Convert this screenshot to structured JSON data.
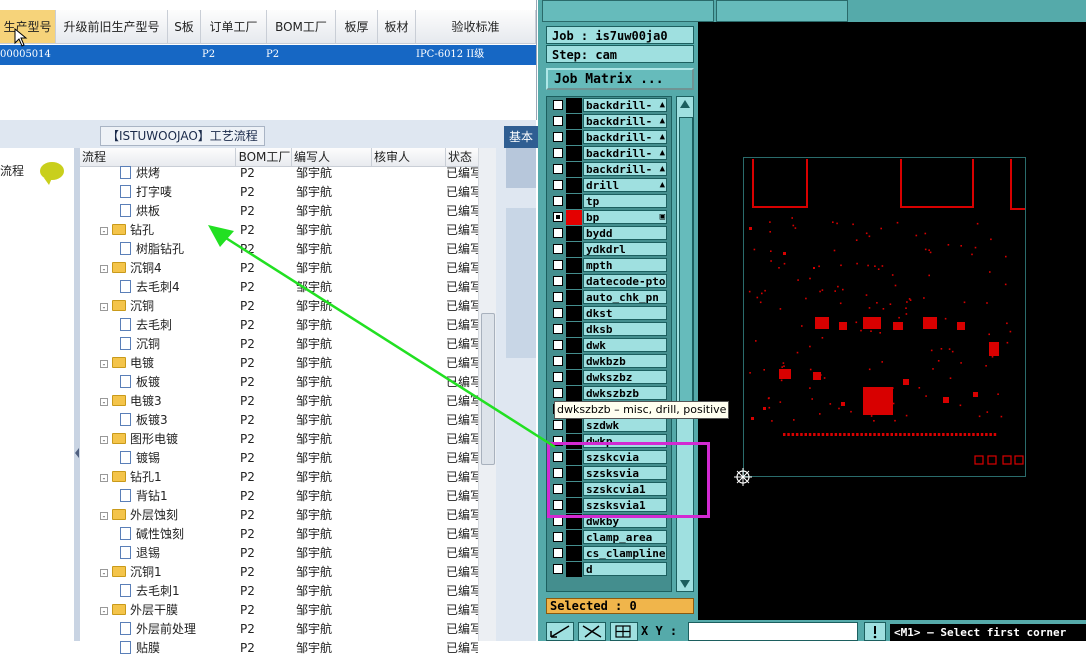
{
  "top_grid": {
    "headers": [
      "生产型号",
      "升级前旧生产型号",
      "S板",
      "订单工厂",
      "BOM工厂",
      "板厚",
      "板材",
      "验收标准"
    ],
    "row": {
      "model": "00005014",
      "order_factory": "P2",
      "bom_factory": "P2",
      "standard": "IPC-6012 II级"
    }
  },
  "process_panel": {
    "title": "【ISTUWOOJAO】工艺流程",
    "left_label": "流程",
    "tab_basic": "基本",
    "tree_headers": [
      "流程",
      "BOM工厂",
      "编写人",
      "核审人",
      "状态"
    ],
    "rows": [
      {
        "indent": 2,
        "kind": "doc",
        "name": "烘烤",
        "factory": "P2",
        "author": "邹宇航",
        "status": "已编写"
      },
      {
        "indent": 2,
        "kind": "doc",
        "name": "打字唛",
        "factory": "P2",
        "author": "邹宇航",
        "status": "已编写"
      },
      {
        "indent": 2,
        "kind": "doc",
        "name": "烘板",
        "factory": "P2",
        "author": "邹宇航",
        "status": "已编写"
      },
      {
        "indent": 1,
        "kind": "folder",
        "name": "钻孔",
        "factory": "P2",
        "author": "邹宇航",
        "status": "已编写"
      },
      {
        "indent": 2,
        "kind": "doc",
        "name": "树脂钻孔",
        "factory": "P2",
        "author": "邹宇航",
        "status": "已编写"
      },
      {
        "indent": 1,
        "kind": "folder",
        "name": "沉铜4",
        "factory": "P2",
        "author": "邹宇航",
        "status": "已编写"
      },
      {
        "indent": 2,
        "kind": "doc",
        "name": "去毛刺4",
        "factory": "P2",
        "author": "邹宇航",
        "status": "已编写"
      },
      {
        "indent": 1,
        "kind": "folder",
        "name": "沉铜",
        "factory": "P2",
        "author": "邹宇航",
        "status": "已编写"
      },
      {
        "indent": 2,
        "kind": "doc",
        "name": "去毛刺",
        "factory": "P2",
        "author": "邹宇航",
        "status": "已编写"
      },
      {
        "indent": 2,
        "kind": "doc",
        "name": "沉铜",
        "factory": "P2",
        "author": "邹宇航",
        "status": "已编写"
      },
      {
        "indent": 1,
        "kind": "folder",
        "name": "电镀",
        "factory": "P2",
        "author": "邹宇航",
        "status": "已编写"
      },
      {
        "indent": 2,
        "kind": "doc",
        "name": "板镀",
        "factory": "P2",
        "author": "邹宇航",
        "status": "已编写"
      },
      {
        "indent": 1,
        "kind": "folder",
        "name": "电镀3",
        "factory": "P2",
        "author": "邹宇航",
        "status": "已编写"
      },
      {
        "indent": 2,
        "kind": "doc",
        "name": "板镀3",
        "factory": "P2",
        "author": "邹宇航",
        "status": "已编写"
      },
      {
        "indent": 1,
        "kind": "folder",
        "name": "图形电镀",
        "factory": "P2",
        "author": "邹宇航",
        "status": "已编写"
      },
      {
        "indent": 2,
        "kind": "doc",
        "name": "镀锡",
        "factory": "P2",
        "author": "邹宇航",
        "status": "已编写"
      },
      {
        "indent": 1,
        "kind": "folder",
        "name": "钻孔1",
        "factory": "P2",
        "author": "邹宇航",
        "status": "已编写"
      },
      {
        "indent": 2,
        "kind": "doc",
        "name": "背钻1",
        "factory": "P2",
        "author": "邹宇航",
        "status": "已编写"
      },
      {
        "indent": 1,
        "kind": "folder",
        "name": "外层蚀刻",
        "factory": "P2",
        "author": "邹宇航",
        "status": "已编写"
      },
      {
        "indent": 2,
        "kind": "doc",
        "name": "碱性蚀刻",
        "factory": "P2",
        "author": "邹宇航",
        "status": "已编写"
      },
      {
        "indent": 2,
        "kind": "doc",
        "name": "退锡",
        "factory": "P2",
        "author": "邹宇航",
        "status": "已编写"
      },
      {
        "indent": 1,
        "kind": "folder",
        "name": "沉铜1",
        "factory": "P2",
        "author": "邹宇航",
        "status": "已编写"
      },
      {
        "indent": 2,
        "kind": "doc",
        "name": "去毛刺1",
        "factory": "P2",
        "author": "邹宇航",
        "status": "已编写"
      },
      {
        "indent": 1,
        "kind": "folder",
        "name": "外层干膜",
        "factory": "P2",
        "author": "邹宇航",
        "status": "已编写"
      },
      {
        "indent": 2,
        "kind": "doc",
        "name": "外层前处理",
        "factory": "P2",
        "author": "邹宇航",
        "status": "已编写"
      },
      {
        "indent": 2,
        "kind": "doc",
        "name": "贴膜",
        "factory": "P2",
        "author": "邹宇航",
        "status": "已编写"
      }
    ]
  },
  "genesis": {
    "job_label": "Job : is7uw00ja0",
    "step_label": "Step: cam",
    "matrix_button": "Job Matrix ...",
    "layers": [
      {
        "name": "backdrill-",
        "tag": "▲"
      },
      {
        "name": "backdrill-",
        "tag": "▲"
      },
      {
        "name": "backdrill-",
        "tag": "▲"
      },
      {
        "name": "backdrill-",
        "tag": "▲"
      },
      {
        "name": "backdrill-",
        "tag": "▲"
      },
      {
        "name": "drill",
        "tag": "▲"
      },
      {
        "name": "tp",
        "tag": ""
      },
      {
        "name": "bp",
        "tag": "▣",
        "active": true
      },
      {
        "name": "bydd",
        "tag": ""
      },
      {
        "name": "ydkdrl",
        "tag": ""
      },
      {
        "name": "mpth",
        "tag": ""
      },
      {
        "name": "datecode-pto",
        "tag": ""
      },
      {
        "name": "auto_chk_pn",
        "tag": ""
      },
      {
        "name": "dkst",
        "tag": ""
      },
      {
        "name": "dksb",
        "tag": ""
      },
      {
        "name": "dwk",
        "tag": ""
      },
      {
        "name": "dwkbzb",
        "tag": ""
      },
      {
        "name": "dwkszbz",
        "tag": ""
      },
      {
        "name": "dwkszbzb",
        "tag": ""
      },
      {
        "name": "",
        "tag": ""
      },
      {
        "name": "szdwk",
        "tag": ""
      },
      {
        "name": "dwkp",
        "tag": ""
      },
      {
        "name": "szskcvia",
        "tag": ""
      },
      {
        "name": "szsksvia",
        "tag": ""
      },
      {
        "name": "szskcvia1",
        "tag": ""
      },
      {
        "name": "szsksvia1",
        "tag": ""
      },
      {
        "name": "dwkby",
        "tag": ""
      },
      {
        "name": "clamp_area",
        "tag": ""
      },
      {
        "name": "cs_clampline",
        "tag": ""
      },
      {
        "name": "d",
        "tag": ""
      }
    ],
    "tooltip": "dwkszbzb – misc, drill, positive",
    "selected_label": "Selected : 0",
    "xy_label": "X Y :",
    "status_message": "<M1> – Select first corner"
  },
  "colors": {
    "accent_blue": "#1667c4",
    "genesis_teal": "#55aaaa",
    "board_red": "#d80000",
    "arrow_green": "#22e022",
    "highlight_magenta": "#d22ad2"
  }
}
